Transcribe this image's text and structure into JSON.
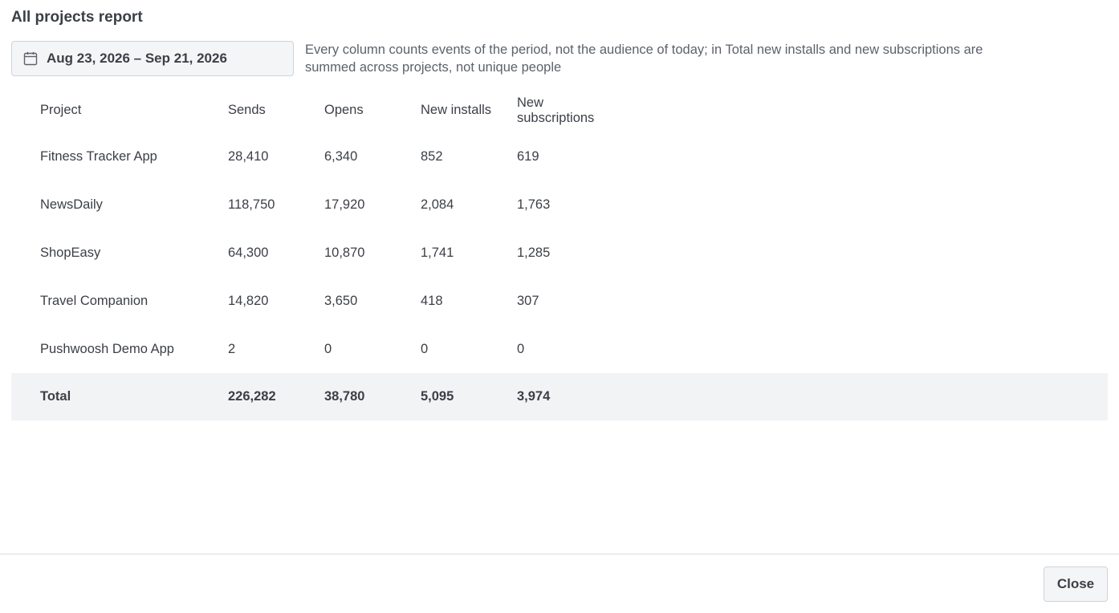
{
  "report": {
    "title": "All projects report",
    "date_range": "Aug 23, 2026 – Sep 21, 2026",
    "date_icon": "calendar-icon",
    "hint": "Every column counts events of the period, not the audience of today; in Total new installs and new subscriptions are summed across projects, not unique people"
  },
  "table": {
    "columns": [
      "Project",
      "Sends",
      "Opens",
      "New installs",
      "New subscriptions"
    ],
    "rows": [
      [
        "Fitness Tracker App",
        "28,410",
        "6,340",
        "852",
        "619"
      ],
      [
        "NewsDaily",
        "118,750",
        "17,920",
        "2,084",
        "1,763"
      ],
      [
        "ShopEasy",
        "64,300",
        "10,870",
        "1,741",
        "1,285"
      ],
      [
        "Travel Companion",
        "14,820",
        "3,650",
        "418",
        "307"
      ],
      [
        "Pushwoosh Demo App",
        "2",
        "0",
        "0",
        "0"
      ]
    ],
    "total": [
      "Total",
      "226,282",
      "38,780",
      "5,095",
      "3,974"
    ]
  },
  "footer": {
    "close_label": "Close"
  },
  "colors": {
    "text": "#3b3f46",
    "muted": "#5c626b",
    "total_bg": "#f2f3f5",
    "border": "#cfd3d9"
  }
}
